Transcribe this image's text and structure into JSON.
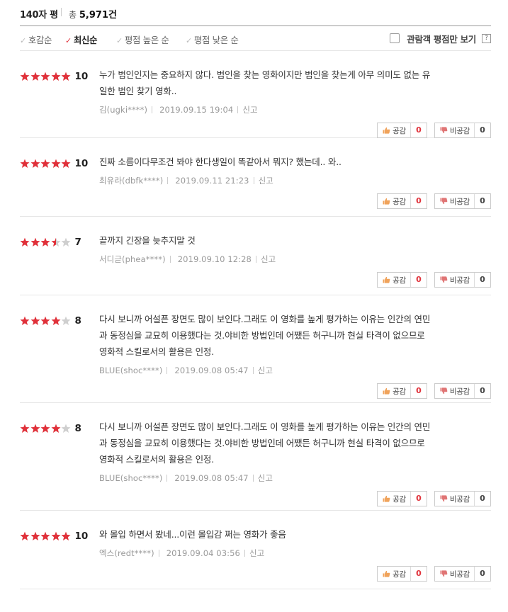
{
  "header": {
    "title": "140자 평",
    "total_prefix": "총",
    "total_count": "5,971건"
  },
  "sort": {
    "items": [
      {
        "label": "호감순",
        "active": false
      },
      {
        "label": "최신순",
        "active": true
      },
      {
        "label": "평점 높은 순",
        "active": false
      },
      {
        "label": "평점 낮은 순",
        "active": false
      }
    ],
    "audience_only_label": "관람객 평점만 보기",
    "help_label": "?"
  },
  "colors": {
    "star_on": "#e0313a",
    "star_off": "#cfcfcf",
    "accent": "#e0313a"
  },
  "buttons": {
    "like_label": "공감",
    "dislike_label": "비공감",
    "report_label": "신고"
  },
  "reviews": [
    {
      "stars": 5,
      "score": "10",
      "lines": [
        "누가 범인인지는 중요하지 않다. 범인을 찾는 영화이지만 범인을 찾는게 아무 의미도 없는 유",
        "일한 범인 찾기 영화.."
      ],
      "author": "김(ugki****)",
      "date": "2019.09.15 19:04",
      "likes": "0",
      "dislikes": "0"
    },
    {
      "stars": 5,
      "score": "10",
      "lines": [
        "진짜 소름이다무조건 봐야 한다생일이 똑같아서 뭐지? 했는데.. 와.."
      ],
      "author": "최유라(dbfk****)",
      "date": "2019.09.11 21:23",
      "likes": "0",
      "dislikes": "0"
    },
    {
      "stars": 3.5,
      "score": "7",
      "lines": [
        "끝까지 긴장을 늦추지말 것"
      ],
      "author": "서디귿(phea****)",
      "date": "2019.09.10 12:28",
      "likes": "0",
      "dislikes": "0"
    },
    {
      "stars": 4,
      "score": "8",
      "lines": [
        "다시 보니까 어설픈 장면도 많이 보인다.그래도 이 영화를 높게 평가하는 이유는 인간의 연민",
        "과 동정심을 교묘히 이용했다는 것.야비한 방법인데 어쨌든 허구니까 현실 타격이 없으므로",
        "영화적 스킬로서의 활용은 인정."
      ],
      "author": "BLUE(shoc****)",
      "date": "2019.09.08 05:47",
      "likes": "0",
      "dislikes": "0"
    },
    {
      "stars": 4,
      "score": "8",
      "lines": [
        "다시 보니까 어설픈 장면도 많이 보인다.그래도 이 영화를 높게 평가하는 이유는 인간의 연민",
        "과 동정심을 교묘히 이용했다는 것.야비한 방법인데 어쨌든 허구니까 현실 타격이 없으므로",
        "영화적 스킬로서의 활용은 인정."
      ],
      "author": "BLUE(shoc****)",
      "date": "2019.09.08 05:47",
      "likes": "0",
      "dislikes": "0"
    },
    {
      "stars": 5,
      "score": "10",
      "lines": [
        "와 몰입 하면서 봤네...이런 몰입감 쩌는 영화가 좋음"
      ],
      "author": "엑스(redt****)",
      "date": "2019.09.04 03:56",
      "likes": "0",
      "dislikes": "0"
    }
  ]
}
